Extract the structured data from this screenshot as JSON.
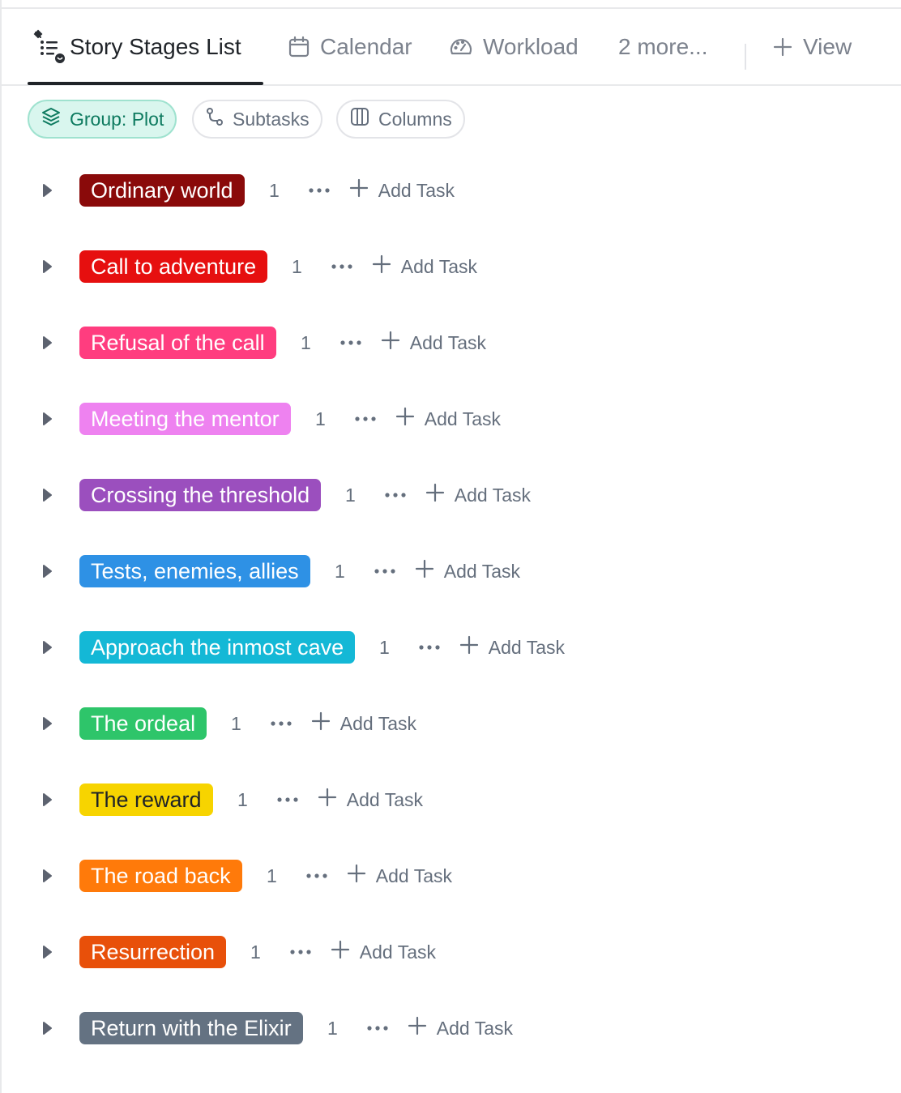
{
  "tabs": [
    {
      "label": "Story Stages List",
      "icon": "list-pin-icon",
      "active": true
    },
    {
      "label": "Calendar",
      "icon": "calendar-icon"
    },
    {
      "label": "Workload",
      "icon": "gauge-icon"
    },
    {
      "label": "2 more..."
    },
    {
      "label": "View",
      "icon": "plus-icon"
    }
  ],
  "toolbar": {
    "group": "Group: Plot",
    "subtasks": "Subtasks",
    "columns": "Columns"
  },
  "groups": [
    {
      "label": "Ordinary world",
      "count": "1",
      "add": "Add Task",
      "color": "#8a0a0a"
    },
    {
      "label": "Call to adventure",
      "count": "1",
      "add": "Add Task",
      "color": "#e60f0f"
    },
    {
      "label": "Refusal of the call",
      "count": "1",
      "add": "Add Task",
      "color": "#ff3d7f"
    },
    {
      "label": "Meeting the mentor",
      "count": "1",
      "add": "Add Task",
      "color": "#ee82f0"
    },
    {
      "label": "Crossing the threshold",
      "count": "1",
      "add": "Add Task",
      "color": "#9b4fbe"
    },
    {
      "label": "Tests, enemies, allies",
      "count": "1",
      "add": "Add Task",
      "color": "#2e91e5"
    },
    {
      "label": "Approach the inmost cave",
      "count": "1",
      "add": "Add Task",
      "color": "#14b8d6"
    },
    {
      "label": "The ordeal",
      "count": "1",
      "add": "Add Task",
      "color": "#2ec56a"
    },
    {
      "label": "The reward",
      "count": "1",
      "add": "Add Task",
      "color": "#f7d400"
    },
    {
      "label": "The road back",
      "count": "1",
      "add": "Add Task",
      "color": "#ff7a0a"
    },
    {
      "label": "Resurrection",
      "count": "1",
      "add": "Add Task",
      "color": "#e8500a"
    },
    {
      "label": "Return with the Elixir",
      "count": "1",
      "add": "Add Task",
      "color": "#647282"
    }
  ]
}
